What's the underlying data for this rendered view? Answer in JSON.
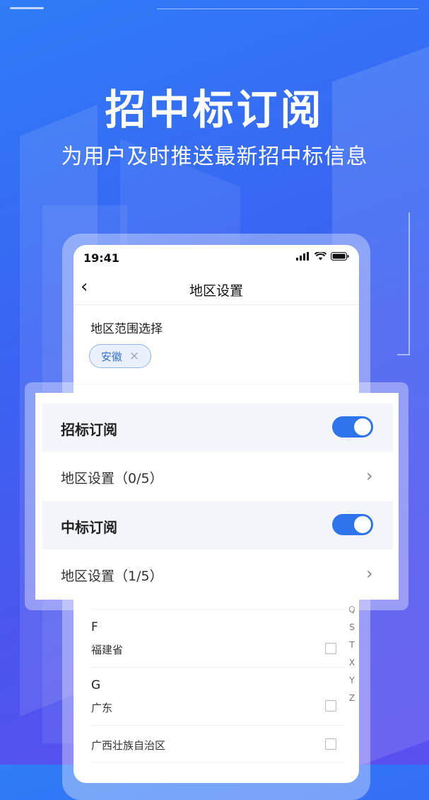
{
  "hero": {
    "title": "招中标订阅",
    "subtitle": "为用户及时推送最新招中标信息"
  },
  "phone": {
    "status_time": "19:41",
    "nav_title": "地区设置",
    "back_icon": "chevron-left-icon",
    "region_section_label": "地区范围选择",
    "selected_chip": {
      "label": "安徽",
      "remove": "×"
    }
  },
  "overlay_card": {
    "bid_subscription": {
      "label": "招标订阅",
      "enabled": true
    },
    "bid_region": {
      "label": "地区设置（0/5）"
    },
    "award_subscription": {
      "label": "中标订阅",
      "enabled": true
    },
    "award_region": {
      "label": "地区设置（1/5）"
    }
  },
  "province_list": {
    "groups": [
      {
        "letter": "F",
        "items": [
          "福建省"
        ]
      },
      {
        "letter": "G",
        "items": [
          "广东",
          "广西壮族自治区"
        ]
      }
    ],
    "index_letters": [
      "Q",
      "S",
      "T",
      "X",
      "Y",
      "Z"
    ]
  },
  "colors": {
    "accent": "#2f74ea",
    "chip_text": "#3470d8",
    "chip_bg": "#eaf1fd"
  }
}
